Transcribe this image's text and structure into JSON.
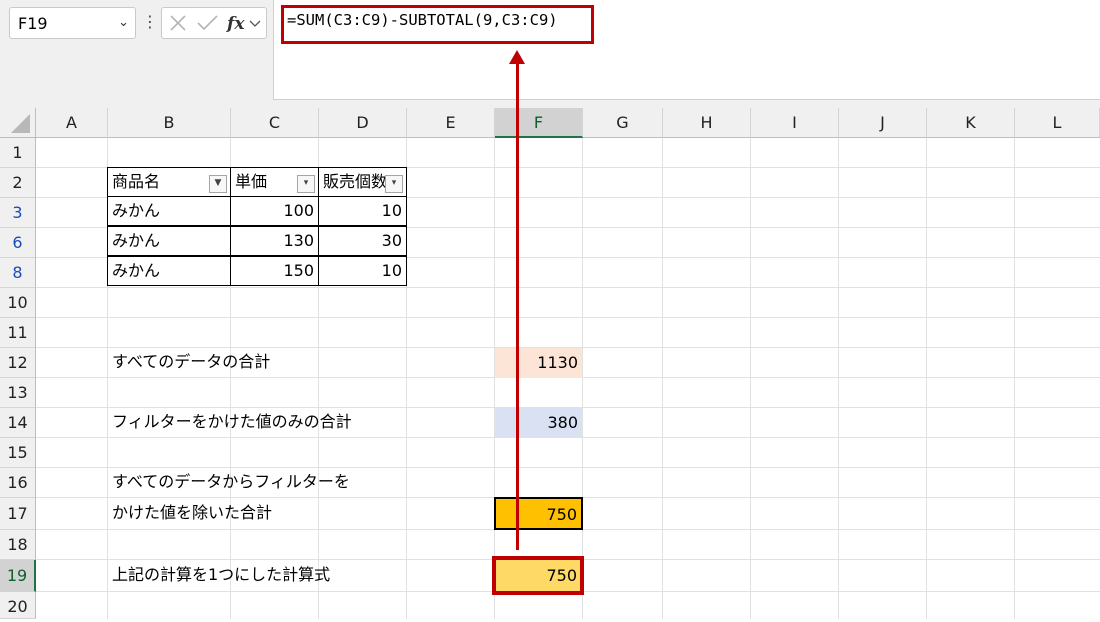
{
  "formula_bar": {
    "name_box": "F19",
    "formula": "=SUM(C3:C9)-SUBTOTAL(9,C3:C9)",
    "fx_label": "fx",
    "cancel_icon": "cancel-x-icon",
    "enter_icon": "check-icon"
  },
  "columns": [
    "A",
    "B",
    "C",
    "D",
    "E",
    "F",
    "G",
    "H",
    "I",
    "J",
    "K",
    "L"
  ],
  "rows": [
    "1",
    "2",
    "3",
    "6",
    "8",
    "10",
    "11",
    "12",
    "13",
    "14",
    "15",
    "16",
    "17",
    "18",
    "19",
    "20"
  ],
  "table": {
    "headers": [
      "商品名",
      "単価",
      "販売個数"
    ],
    "rows": [
      [
        "みかん",
        "100",
        "10"
      ],
      [
        "みかん",
        "130",
        "30"
      ],
      [
        "みかん",
        "150",
        "10"
      ]
    ]
  },
  "cells": {
    "b12": "すべてのデータの合計",
    "f12": "1130",
    "b14": "フィルターをかけた値のみの合計",
    "f14": "380",
    "b16": "すべてのデータからフィルターを",
    "b17": "かけた値を除いた合計",
    "f17": "750",
    "b19": "上記の計算を1つにした計算式",
    "f19": "750"
  },
  "colors": {
    "f12_fill": "#fce4d6",
    "f14_fill": "#d9e1f2",
    "f17_fill": "#ffc000",
    "f19_fill": "#ffd966",
    "highlight_red": "#c00000"
  }
}
